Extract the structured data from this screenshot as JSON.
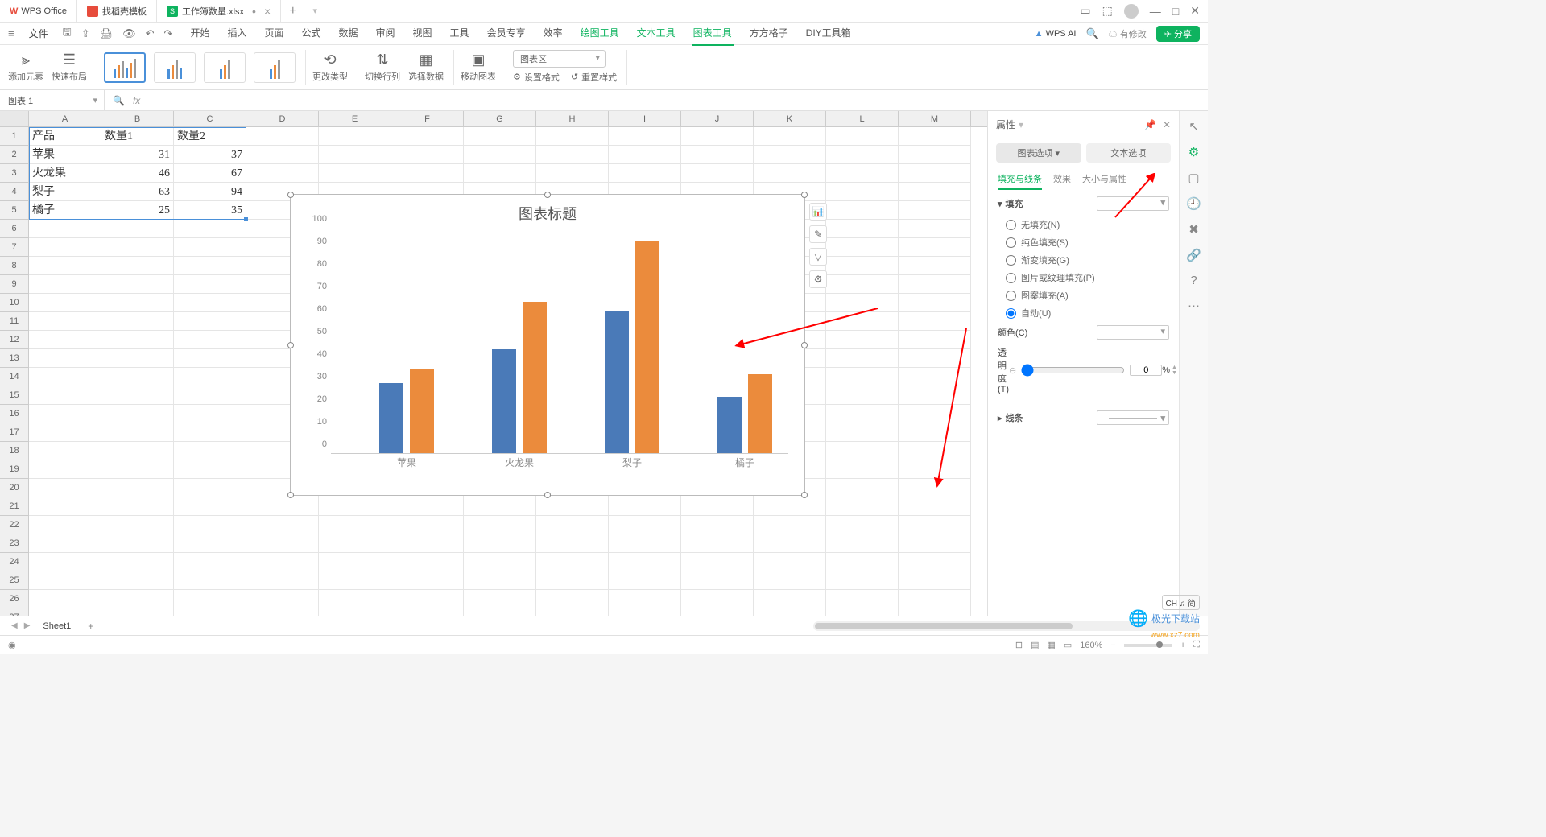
{
  "titlebar": {
    "app_name": "WPS Office",
    "tab_template": "找稻壳模板",
    "tab_file": "工作簿数量.xlsx"
  },
  "menubar": {
    "file": "文件",
    "tabs": [
      "开始",
      "插入",
      "页面",
      "公式",
      "数据",
      "审阅",
      "视图",
      "工具",
      "会员专享",
      "效率",
      "绘图工具",
      "文本工具",
      "图表工具",
      "方方格子",
      "DIY工具箱"
    ],
    "ai": "WPS AI",
    "changes": "有修改",
    "share": "分享"
  },
  "ribbon": {
    "add_element": "添加元素",
    "quick_layout": "快速布局",
    "change_type": "更改类型",
    "switch_rowcol": "切换行列",
    "select_data": "选择数据",
    "move_chart": "移动图表",
    "chart_area": "图表区",
    "set_format": "设置格式",
    "reset_style": "重置样式"
  },
  "namebox": {
    "value": "图表 1",
    "fx": "fx"
  },
  "grid": {
    "cols": [
      "A",
      "B",
      "C",
      "D",
      "E",
      "F",
      "G",
      "H",
      "I",
      "J",
      "K",
      "L",
      "M"
    ],
    "headers": [
      "产品",
      "数量1",
      "数量2"
    ],
    "rows": [
      {
        "a": "苹果",
        "b": "31",
        "c": "37"
      },
      {
        "a": "火龙果",
        "b": "46",
        "c": "67"
      },
      {
        "a": "梨子",
        "b": "63",
        "c": "94"
      },
      {
        "a": "橘子",
        "b": "25",
        "c": "35"
      }
    ]
  },
  "chart_data": {
    "type": "bar",
    "title": "图表标题",
    "categories": [
      "苹果",
      "火龙果",
      "梨子",
      "橘子"
    ],
    "series": [
      {
        "name": "数量1",
        "values": [
          31,
          46,
          63,
          25
        ],
        "color": "#4a7ab8"
      },
      {
        "name": "数量2",
        "values": [
          37,
          67,
          94,
          35
        ],
        "color": "#eb8b3c"
      }
    ],
    "yticks": [
      0,
      10,
      20,
      30,
      40,
      50,
      60,
      70,
      80,
      90,
      100
    ],
    "ylim": [
      0,
      100
    ]
  },
  "panel": {
    "title": "属性",
    "tab_chart": "图表选项",
    "tab_text": "文本选项",
    "sub_fill": "填充与线条",
    "sub_effect": "效果",
    "sub_size": "大小与属性",
    "fill_section": "填充",
    "fill_none": "无填充(N)",
    "fill_solid": "纯色填充(S)",
    "fill_gradient": "渐变填充(G)",
    "fill_picture": "图片或纹理填充(P)",
    "fill_pattern": "图案填充(A)",
    "fill_auto": "自动(U)",
    "color_label": "颜色(C)",
    "opacity_label": "透明度(T)",
    "opacity_value": "0",
    "opacity_unit": "%",
    "line_section": "线条"
  },
  "sheets": {
    "sheet1": "Sheet1"
  },
  "statusbar": {
    "zoom": "160%",
    "ime": "CH ♫ 简"
  },
  "watermark": {
    "text": "极光下载站",
    "url": "www.xz7.com"
  }
}
